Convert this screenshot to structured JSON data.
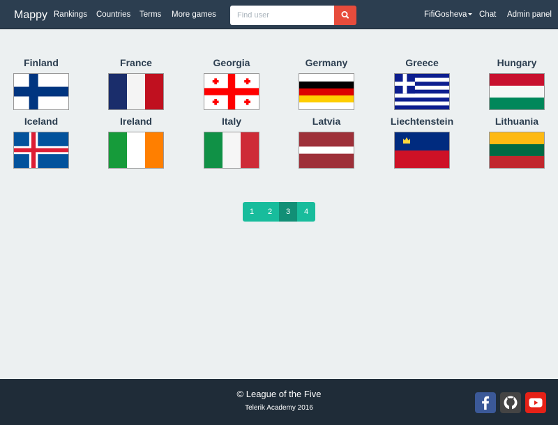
{
  "navbar": {
    "brand": "Mappy",
    "links": [
      "Rankings",
      "Countries",
      "Terms",
      "More games"
    ],
    "search": {
      "placeholder": "Find user",
      "value": ""
    },
    "user_menu": "FifiGosheva",
    "chat": "Chat",
    "admin": "Admin panel"
  },
  "countries": [
    {
      "name": "Finland",
      "flag": "finland-flag"
    },
    {
      "name": "France",
      "flag": "france-flag"
    },
    {
      "name": "Georgia",
      "flag": "georgia-flag"
    },
    {
      "name": "Germany",
      "flag": "germany-flag"
    },
    {
      "name": "Greece",
      "flag": "greece-flag"
    },
    {
      "name": "Hungary",
      "flag": "hungary-flag"
    },
    {
      "name": "Iceland",
      "flag": "iceland-flag"
    },
    {
      "name": "Ireland",
      "flag": "ireland-flag"
    },
    {
      "name": "Italy",
      "flag": "italy-flag"
    },
    {
      "name": "Latvia",
      "flag": "latvia-flag"
    },
    {
      "name": "Liechtenstein",
      "flag": "liechtenstein-flag"
    },
    {
      "name": "Lithuania",
      "flag": "lithuania-flag"
    }
  ],
  "pagination": {
    "pages": [
      "1",
      "2",
      "3",
      "4"
    ],
    "current": "3"
  },
  "footer": {
    "title": "© League of the Five",
    "subtitle": "Telerik Academy 2016",
    "social": [
      "facebook-icon",
      "github-icon",
      "youtube-icon"
    ]
  },
  "colors": {
    "navbar": "#2c3e50",
    "background": "#ecf0f1",
    "accent": "#18bc9c",
    "accent_active": "#128f76",
    "search_button": "#e74c3c",
    "footer": "#1f2c38"
  }
}
